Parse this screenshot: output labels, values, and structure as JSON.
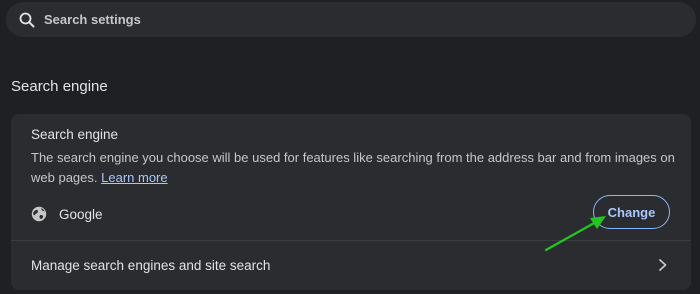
{
  "search": {
    "placeholder": "Search settings"
  },
  "section": {
    "title": "Search engine"
  },
  "card": {
    "title": "Search engine",
    "description": "The search engine you choose will be used for features like searching from the address bar and from images on web pages.",
    "learn_more_label": "Learn more",
    "engine_name": "Google",
    "change_label": "Change",
    "manage_label": "Manage search engines and site search"
  },
  "icons": {
    "search": "search-icon",
    "globe": "globe-icon",
    "chevron": "chevron-right-icon",
    "annotation_arrow": "arrow-icon"
  },
  "colors": {
    "background": "#1f2023",
    "surface": "#2b2c30",
    "accent": "#a8c7fa",
    "annotation": "#22c522"
  }
}
